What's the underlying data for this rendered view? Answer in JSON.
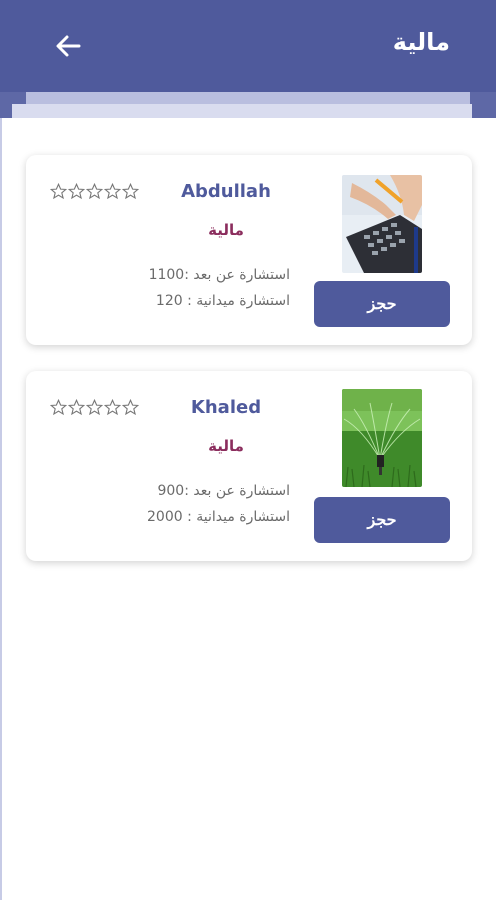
{
  "header": {
    "title": "مالية",
    "background": "#4f5a9c"
  },
  "consultants": [
    {
      "name": "Abdullah",
      "category": "مالية",
      "remote_line": "استشارة  عن بعد :1100",
      "field_line": "استشارة ميدانية : 120",
      "rating": 0,
      "max_rating": 5,
      "book_label": "حجز",
      "photo_icon": "calculator-photo"
    },
    {
      "name": "Khaled",
      "category": "مالية",
      "remote_line": "استشارة  عن بعد :900",
      "field_line": "استشارة ميدانية : 2000",
      "rating": 0,
      "max_rating": 5,
      "book_label": "حجز",
      "photo_icon": "sprinkler-photo"
    }
  ]
}
